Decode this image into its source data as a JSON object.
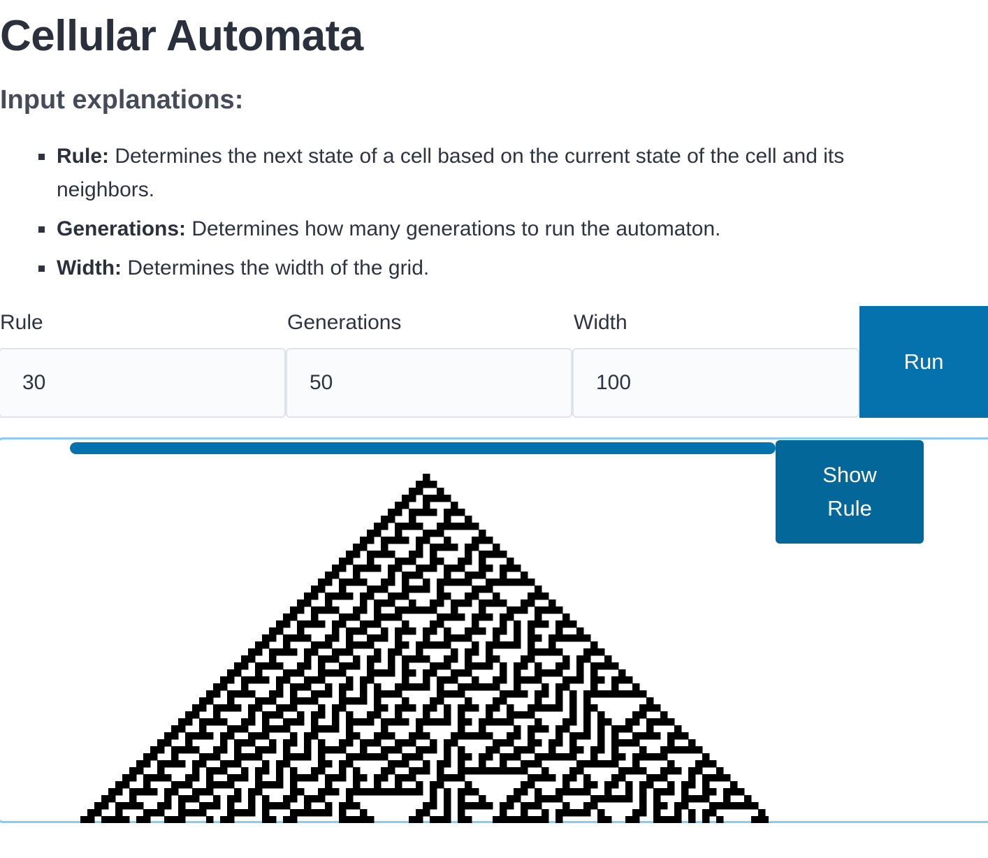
{
  "page": {
    "title": "Cellular Automata",
    "subtitle": "Input explanations:"
  },
  "explanations": [
    {
      "term": "Rule:",
      "text": " Determines the next state of a cell based on the current state of the cell and its neighbors."
    },
    {
      "term": "Generations:",
      "text": " Determines how many generations to run the automaton."
    },
    {
      "term": "Width:",
      "text": " Determines the width of the grid."
    }
  ],
  "form": {
    "rule": {
      "label": "Rule",
      "value": "30"
    },
    "generations": {
      "label": "Generations",
      "value": "50"
    },
    "width": {
      "label": "Width",
      "value": "100"
    },
    "run_label": "Run"
  },
  "output": {
    "progress_fraction": 1.0,
    "show_rule_label_line1": "Show",
    "show_rule_label_line2": "Rule",
    "cell_color": "#000000",
    "background_color": "#ffffff"
  },
  "colors": {
    "accent": "#0572ae",
    "show_rule_bg": "#046799",
    "panel_border": "#8ecaed",
    "text": "#2d3340"
  }
}
